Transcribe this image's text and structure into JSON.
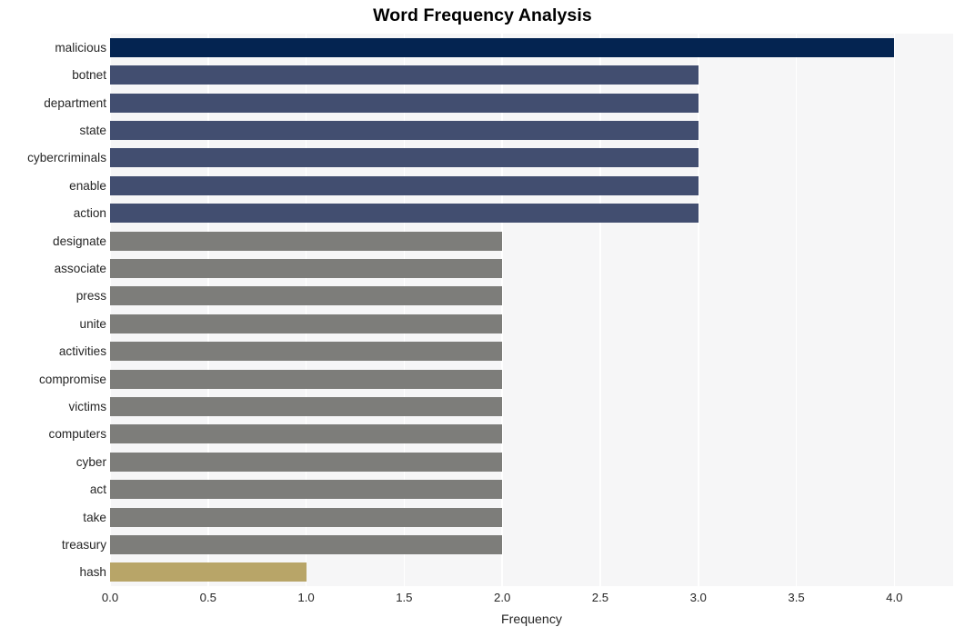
{
  "chart_data": {
    "type": "bar",
    "orientation": "horizontal",
    "title": "Word Frequency Analysis",
    "xlabel": "Frequency",
    "ylabel": "",
    "xlim": [
      0.0,
      4.3
    ],
    "xticks": [
      "0.0",
      "0.5",
      "1.0",
      "1.5",
      "2.0",
      "2.5",
      "3.0",
      "3.5",
      "4.0"
    ],
    "xtick_values": [
      0.0,
      0.5,
      1.0,
      1.5,
      2.0,
      2.5,
      3.0,
      3.5,
      4.0
    ],
    "grid": "vertical-white-on-gray",
    "legend": "none",
    "categories": [
      "malicious",
      "botnet",
      "department",
      "state",
      "cybercriminals",
      "enable",
      "action",
      "designate",
      "associate",
      "press",
      "unite",
      "activities",
      "compromise",
      "victims",
      "computers",
      "cyber",
      "act",
      "take",
      "treasury",
      "hash"
    ],
    "values": [
      4,
      3,
      3,
      3,
      3,
      3,
      3,
      2,
      2,
      2,
      2,
      2,
      2,
      2,
      2,
      2,
      2,
      2,
      2,
      1
    ],
    "bar_colors": [
      "#042451",
      "#424e70",
      "#424e70",
      "#424e70",
      "#424e70",
      "#424e70",
      "#424e70",
      "#7d7d7a",
      "#7d7d7a",
      "#7d7d7a",
      "#7d7d7a",
      "#7d7d7a",
      "#7d7d7a",
      "#7d7d7a",
      "#7d7d7a",
      "#7d7d7a",
      "#7d7d7a",
      "#7d7d7a",
      "#7d7d7a",
      "#b8a568"
    ]
  },
  "style": {
    "plot_background": "#f6f6f7",
    "figure_background": "#ffffff",
    "gridline_color": "#ffffff",
    "text_color": "#262626",
    "title_color": "#000000"
  }
}
